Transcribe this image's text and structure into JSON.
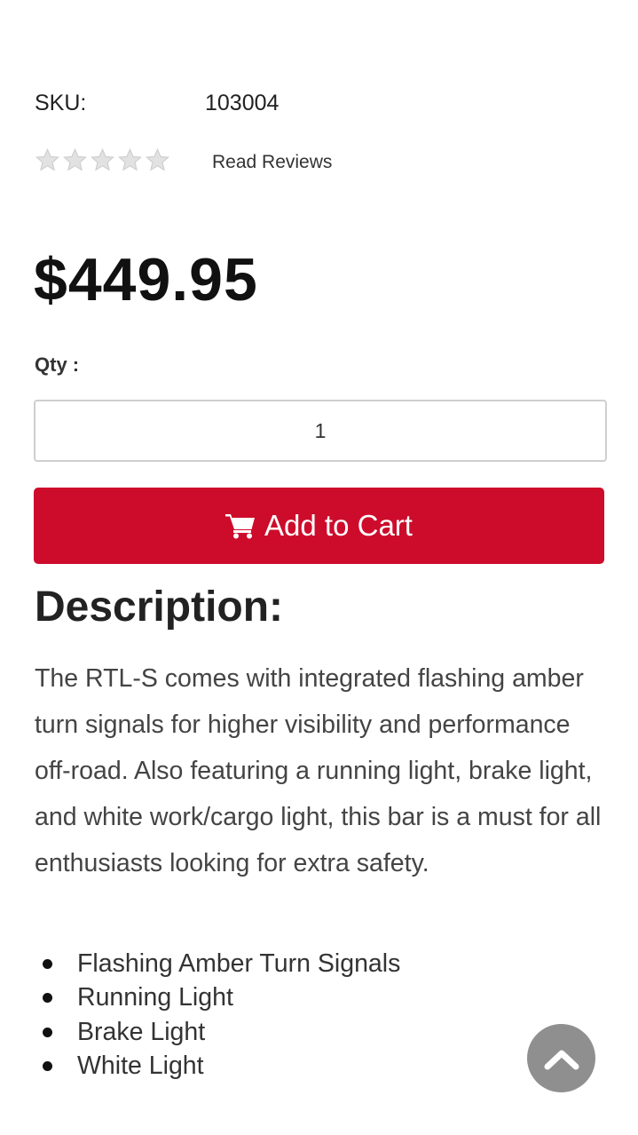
{
  "product": {
    "sku_label": "SKU:",
    "sku_value": "103004",
    "rating": {
      "stars": 5,
      "filled": 0,
      "read_reviews_label": "Read Reviews"
    },
    "price": "$449.95",
    "qty_label": "Qty :",
    "qty_value": "1",
    "add_to_cart_label": "Add to Cart",
    "add_to_cart_icon": "cart-icon",
    "button_color": "#cd0c2b"
  },
  "description": {
    "title": "Description:",
    "text": "The RTL-S comes with integrated flashing amber turn signals for higher visibility and performance off-road. Also featuring a running light, brake light, and white work/cargo light, this bar is a must for all enthusiasts looking for extra safety.",
    "features": [
      "Flashing Amber Turn Signals",
      "Running Light",
      "Brake Light",
      "White Light"
    ]
  },
  "back_to_top": {
    "icon": "chevron-up-icon",
    "color": "#8f8f8f"
  }
}
